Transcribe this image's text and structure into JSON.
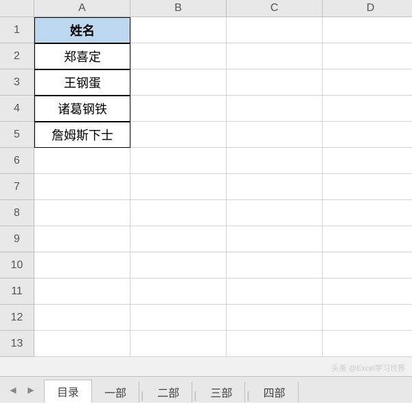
{
  "columns": [
    "A",
    "B",
    "C",
    "D"
  ],
  "rows": [
    "1",
    "2",
    "3",
    "4",
    "5",
    "6",
    "7",
    "8",
    "9",
    "10",
    "11",
    "12",
    "13"
  ],
  "cells": {
    "A1": "姓名",
    "A2": "郑喜定",
    "A3": "王钢蛋",
    "A4": "诸葛钢铁",
    "A5": "詹姆斯下士"
  },
  "tabs": {
    "active": "目录",
    "items": [
      "目录",
      "一部",
      "二部",
      "三部",
      "四部"
    ]
  },
  "watermark": "头条 @Excel学习世界"
}
